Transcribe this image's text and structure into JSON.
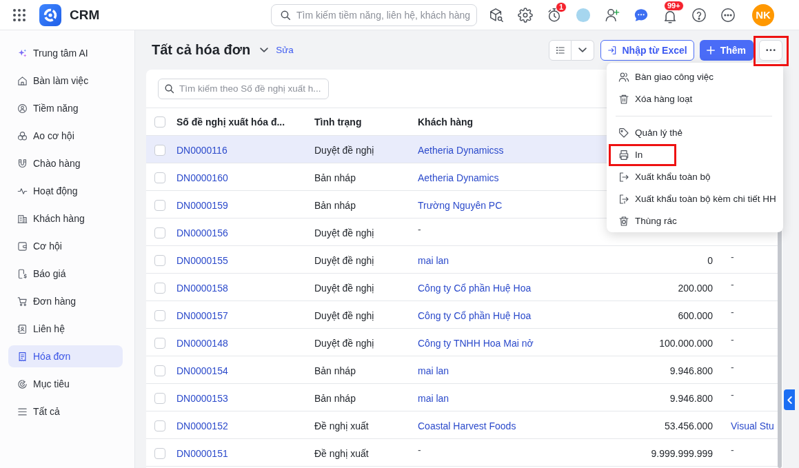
{
  "topbar": {
    "app_name": "CRM",
    "search": {
      "placeholder": "Tìm kiếm tiềm năng, liên hệ, khách hàng"
    },
    "timer_badge": "1",
    "notification_badge": "99+",
    "user_initials": "NK"
  },
  "sidebar": {
    "items": [
      {
        "label": "Trung tâm AI",
        "selected": false
      },
      {
        "label": "Bàn làm việc",
        "selected": false
      },
      {
        "label": "Tiềm năng",
        "selected": false
      },
      {
        "label": "Ao cơ hội",
        "selected": false
      },
      {
        "label": "Chào hàng",
        "selected": false
      },
      {
        "label": "Hoạt động",
        "selected": false
      },
      {
        "label": "Khách hàng",
        "selected": false
      },
      {
        "label": "Cơ hội",
        "selected": false
      },
      {
        "label": "Báo giá",
        "selected": false
      },
      {
        "label": "Đơn hàng",
        "selected": false
      },
      {
        "label": "Liên hệ",
        "selected": false
      },
      {
        "label": "Hóa đơn",
        "selected": true
      },
      {
        "label": "Mục tiêu",
        "selected": false
      },
      {
        "label": "Tất cả",
        "selected": false
      }
    ]
  },
  "header": {
    "title": "Tất cả hóa đơn",
    "edit_link": "Sửa",
    "import_button": "Nhập từ Excel",
    "add_button": "Thêm",
    "more_button": {
      "highlighted": true
    }
  },
  "more_menu": {
    "sections": [
      {
        "items": [
          {
            "label": "Bàn giao công việc",
            "highlighted": false
          },
          {
            "label": "Xóa hàng loạt",
            "highlighted": false
          }
        ]
      },
      {
        "items": [
          {
            "label": "Quản lý thẻ",
            "highlighted": false
          },
          {
            "label": "In",
            "highlighted": true
          },
          {
            "label": "Xuất khẩu toàn bộ",
            "highlighted": false
          },
          {
            "label": "Xuất khẩu toàn bộ kèm chi tiết HH",
            "highlighted": false
          },
          {
            "label": "Thùng rác",
            "highlighted": false
          }
        ]
      }
    ]
  },
  "table": {
    "search": {
      "placeholder": "Tìm kiếm theo Số đề nghị xuất h..."
    },
    "select_all": {
      "checked": false
    },
    "columns": [
      "Số đề nghị xuất hóa đ...",
      "Tình trạng",
      "Khách hàng"
    ],
    "rows": [
      {
        "number": "DN0000116",
        "status": "Duyệt đề nghị",
        "customer": {
          "text": "Aetheria Dynamicss",
          "kind": "link"
        },
        "checked": false,
        "highlighted": true
      },
      {
        "number": "DN0000160",
        "status": "Bản nháp",
        "customer": {
          "text": "Aetheria Dynamics",
          "kind": "link"
        },
        "checked": false,
        "highlighted": false
      },
      {
        "number": "DN0000159",
        "status": "Bản nháp",
        "customer": {
          "text": "Trường Nguyên PC",
          "kind": "link"
        },
        "checked": false,
        "highlighted": false
      },
      {
        "number": "DN0000156",
        "status": "Duyệt đề nghị",
        "customer": {
          "text": "-",
          "kind": "empty"
        },
        "checked": false,
        "highlighted": false
      },
      {
        "number": "DN0000155",
        "status": "Duyệt đề nghị",
        "customer": {
          "text": "mai lan",
          "kind": "link"
        },
        "column_4": "0",
        "column_5": {
          "text": "-",
          "kind": "empty"
        },
        "checked": false,
        "highlighted": false
      },
      {
        "number": "DN0000158",
        "status": "Duyệt đề nghị",
        "customer": {
          "text": "Công ty Cổ phần Huệ Hoa",
          "kind": "link"
        },
        "column_4": "200.000",
        "column_5": {
          "text": "-",
          "kind": "empty"
        },
        "checked": false,
        "highlighted": false
      },
      {
        "number": "DN0000157",
        "status": "Duyệt đề nghị",
        "customer": {
          "text": "Công ty Cổ phần Huệ Hoa",
          "kind": "link"
        },
        "column_4": "600.000",
        "column_5": {
          "text": "-",
          "kind": "empty"
        },
        "checked": false,
        "highlighted": false
      },
      {
        "number": "DN0000148",
        "status": "Duyệt đề nghị",
        "customer": {
          "text": "Công ty TNHH Hoa Mai nở",
          "kind": "link"
        },
        "column_4": "100.000.000",
        "column_5": {
          "text": "-",
          "kind": "empty"
        },
        "checked": false,
        "highlighted": false
      },
      {
        "number": "DN0000154",
        "status": "Bản nháp",
        "customer": {
          "text": "mai lan",
          "kind": "link"
        },
        "column_4": "9.946.800",
        "column_5": {
          "text": "-",
          "kind": "empty"
        },
        "checked": false,
        "highlighted": false
      },
      {
        "number": "DN0000153",
        "status": "Bản nháp",
        "customer": {
          "text": "mai lan",
          "kind": "link"
        },
        "column_4": "9.946.800",
        "column_5": {
          "text": "-",
          "kind": "empty"
        },
        "checked": false,
        "highlighted": false
      },
      {
        "number": "DN0000152",
        "status": "Đề nghị xuất",
        "customer": {
          "text": "Coastal Harvest Foods",
          "kind": "link"
        },
        "column_4": "53.456.000",
        "column_5": {
          "text": "Visual Stu",
          "kind": "link"
        },
        "checked": false,
        "highlighted": false
      },
      {
        "number": "DN0000151",
        "status": "Đề nghị xuất",
        "customer": {
          "text": "-",
          "kind": "empty"
        },
        "column_4": "9.999.999.999",
        "column_5": {
          "text": "-",
          "kind": "empty"
        },
        "checked": false,
        "highlighted": false
      }
    ]
  }
}
